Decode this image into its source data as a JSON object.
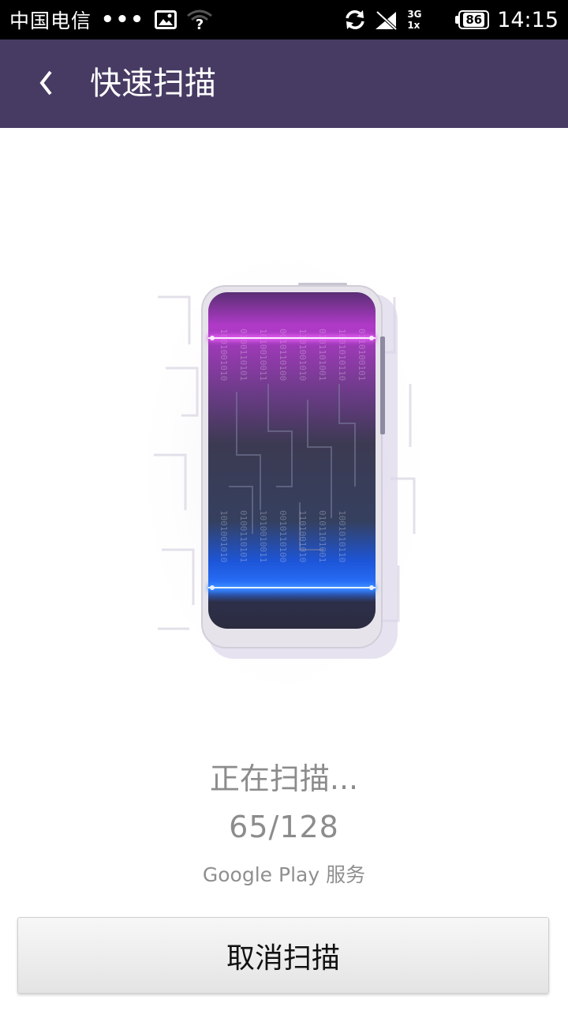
{
  "status_bar": {
    "carrier": "中国电信",
    "dots": "•••",
    "network_top": "3G",
    "network_bottom": "1x",
    "battery": "86",
    "time": "14:15"
  },
  "header": {
    "back_icon": "chevron-left-icon",
    "title": "快速扫描"
  },
  "scan": {
    "status": "正在扫描...",
    "progress": "65/128",
    "current_app": "Google Play 服务"
  },
  "actions": {
    "cancel_label": "取消扫描"
  },
  "colors": {
    "header_bg": "#473b63",
    "scan_top": "#c23cd6",
    "scan_bottom": "#2d6df5"
  }
}
